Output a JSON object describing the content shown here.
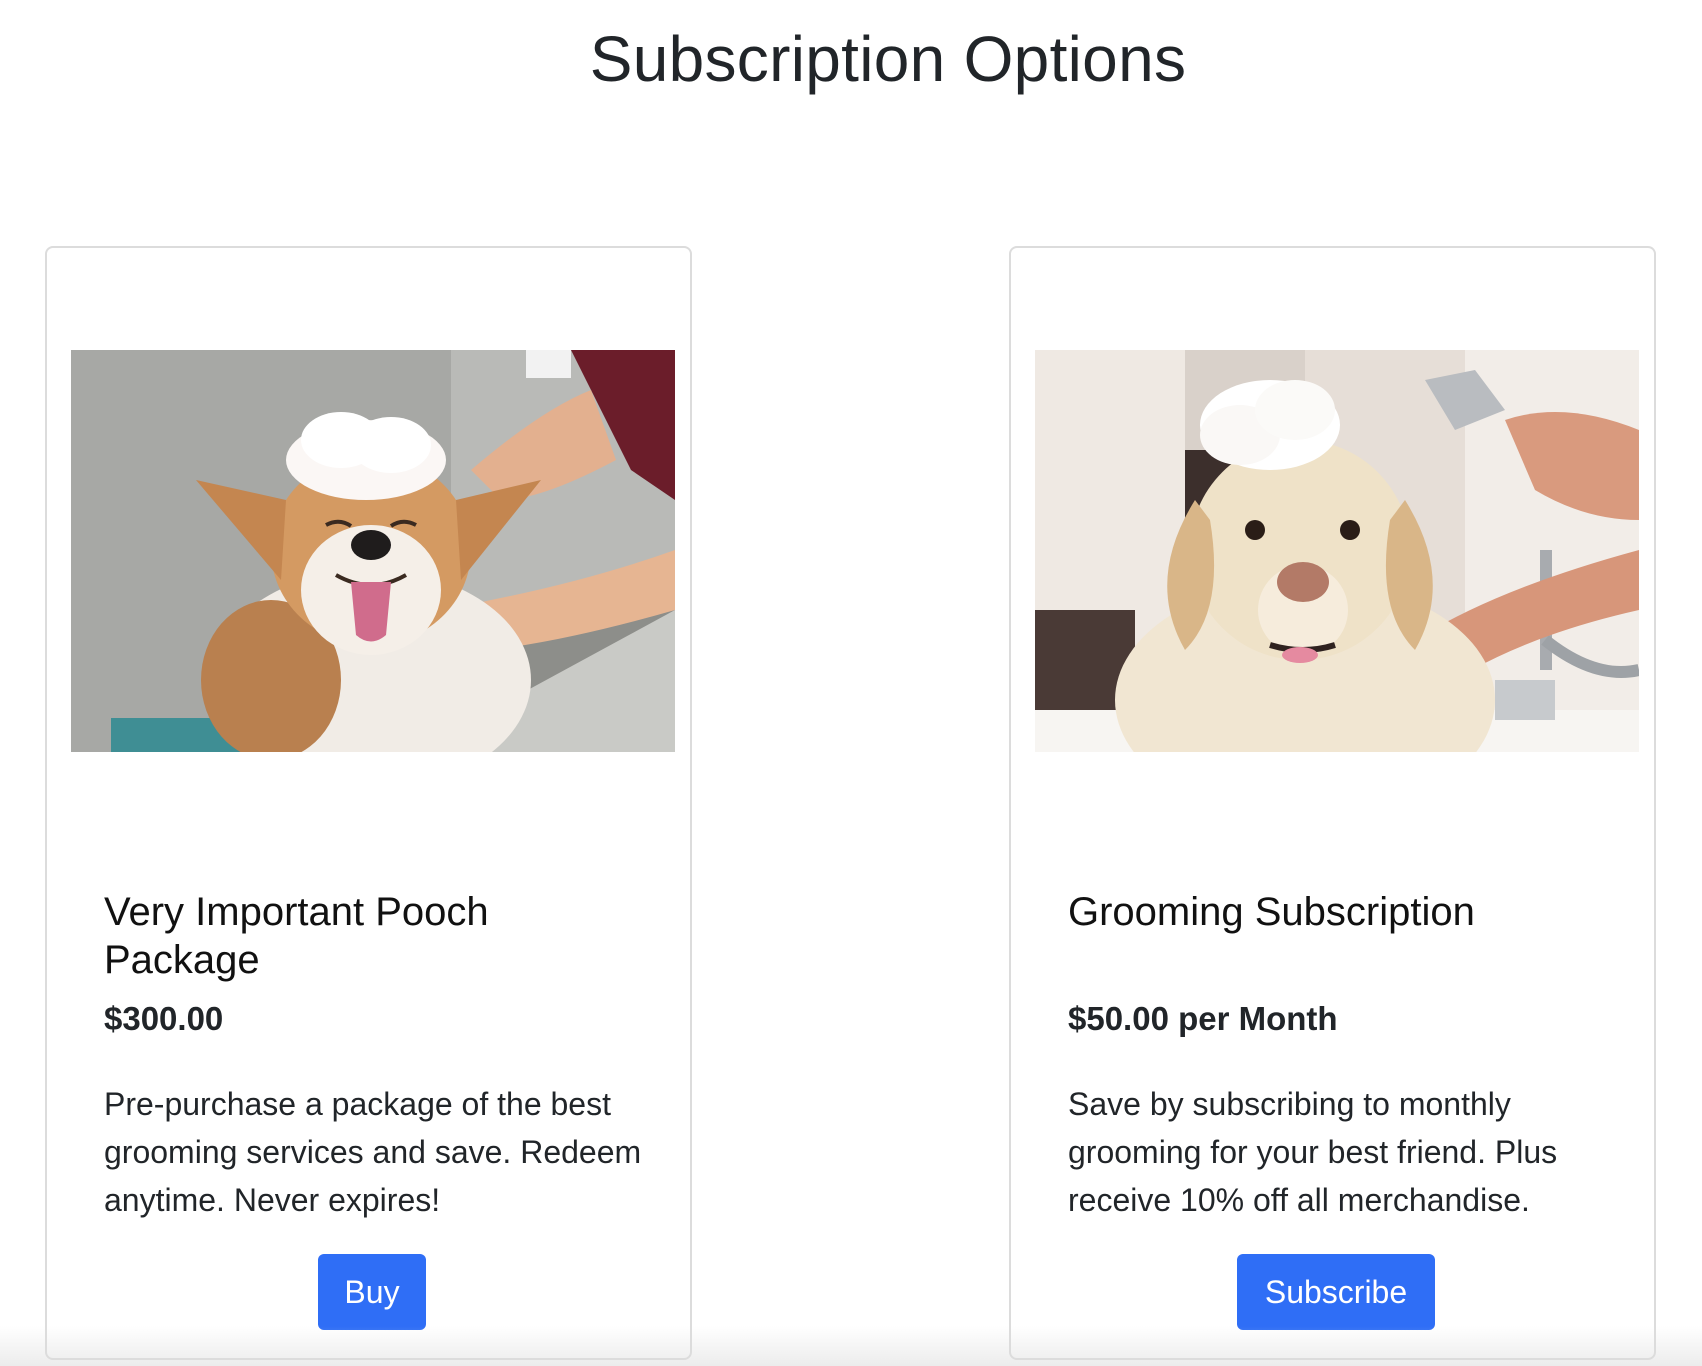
{
  "page": {
    "title": "Subscription Options"
  },
  "cards": [
    {
      "image_subject": "corgi-bath-photo",
      "title": "Very Important Pooch Package",
      "price": "$300.00",
      "description": "Pre-purchase a package of the best grooming services and save. Redeem anytime. Never expires!",
      "button_label": "Buy"
    },
    {
      "image_subject": "labrador-bath-photo",
      "title": "Grooming Subscription",
      "price": "$50.00 per Month",
      "description": "Save by subscribing to monthly grooming for your best friend. Plus receive 10% off all merchandise.",
      "button_label": "Subscribe"
    }
  ],
  "colors": {
    "button": "#2f6ef6",
    "button_text": "#ffffff",
    "card_border": "#dcdcdc",
    "heading": "#212529"
  }
}
